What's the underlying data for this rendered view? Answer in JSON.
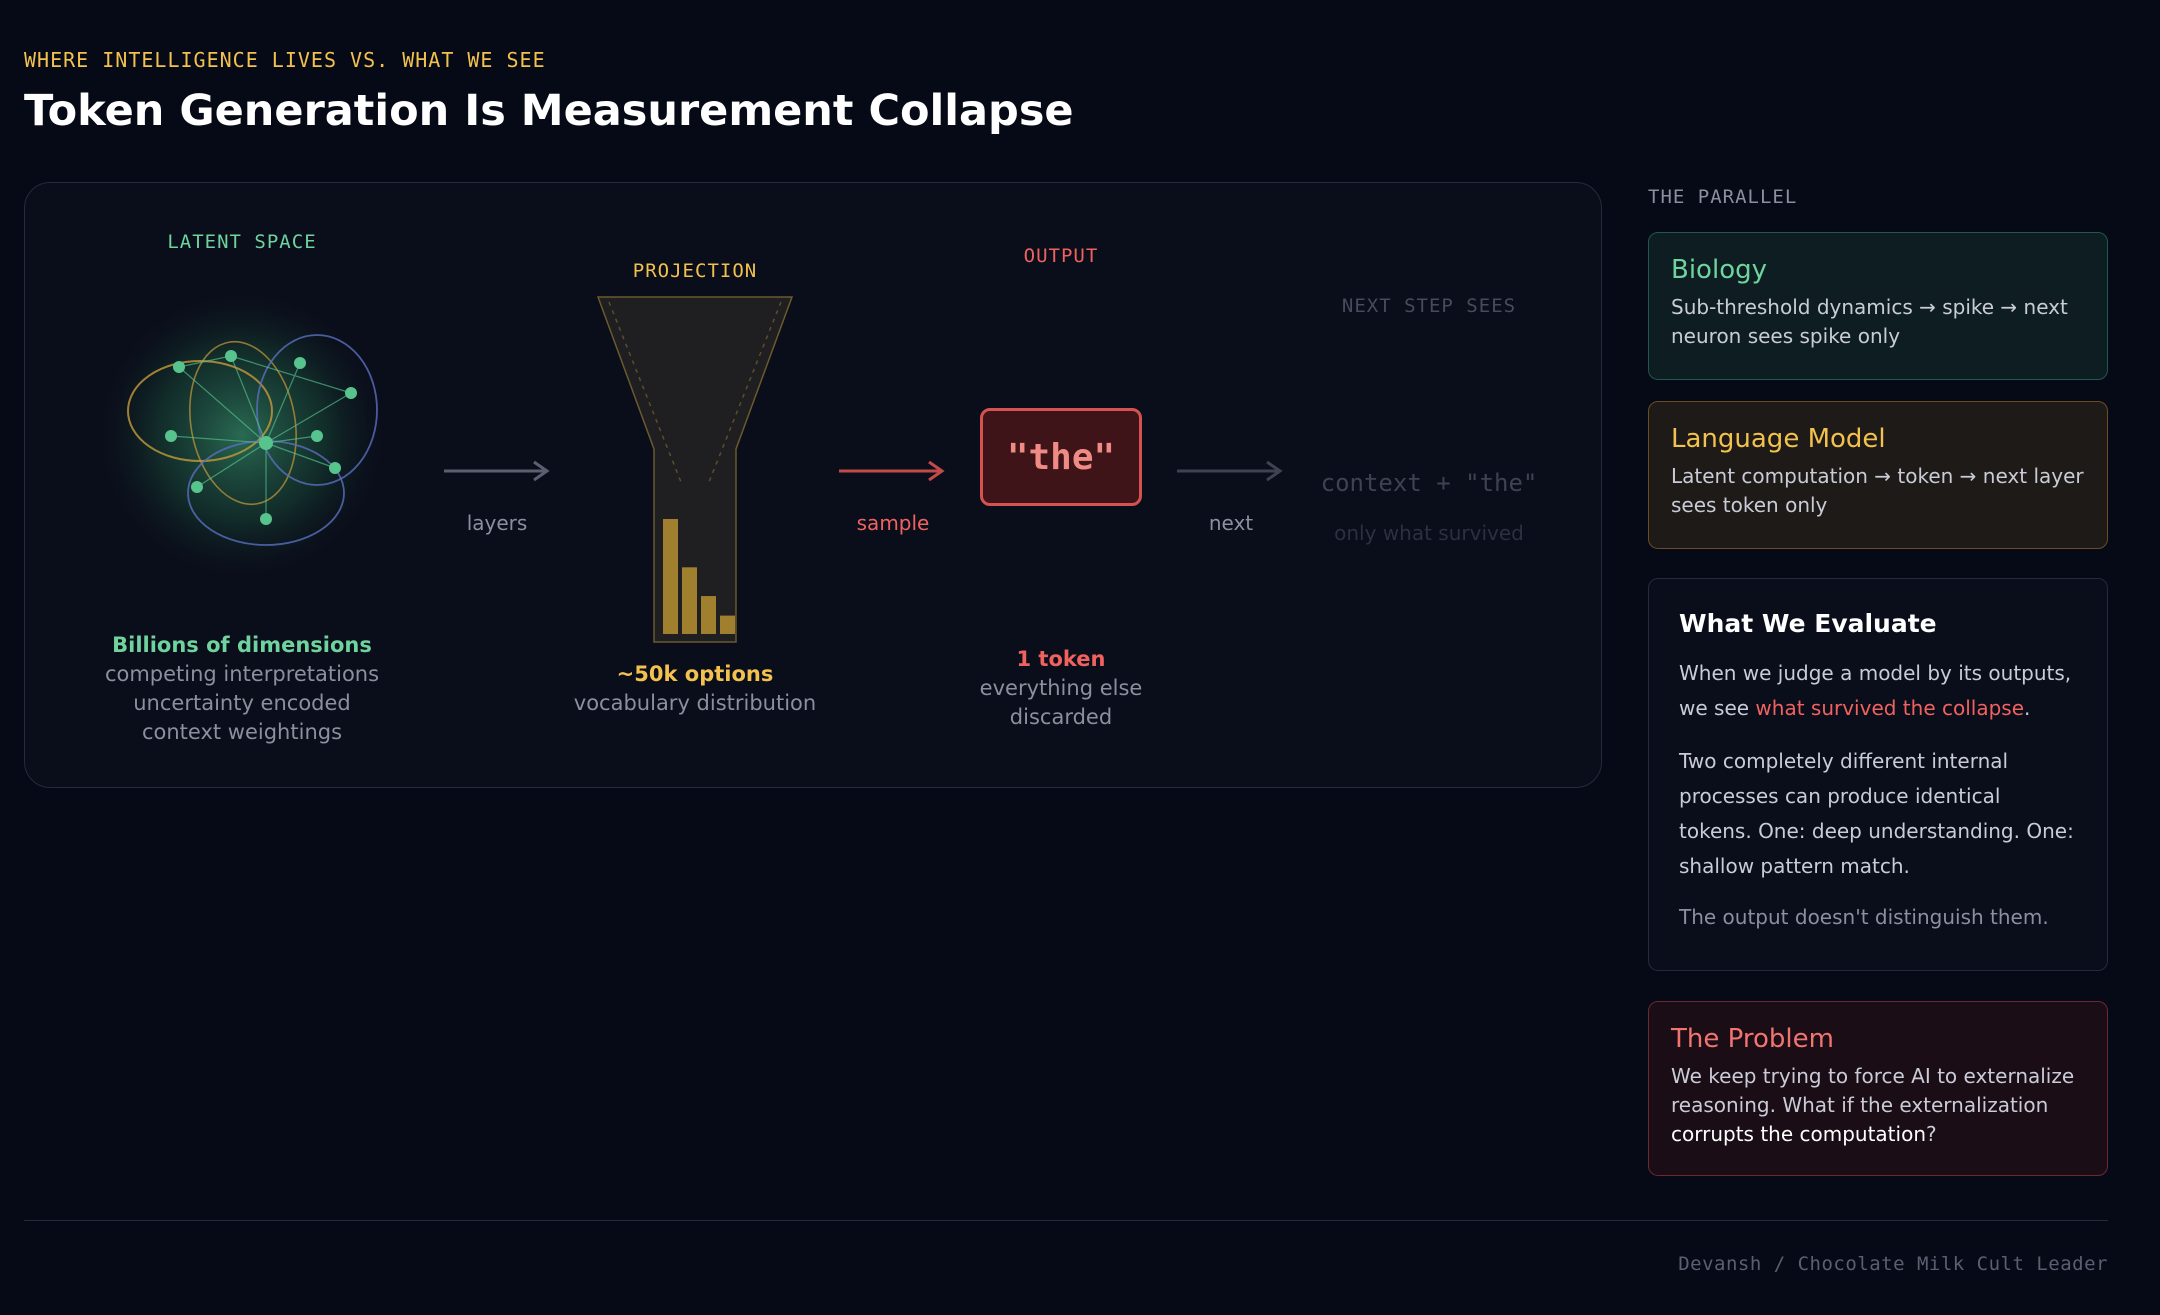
{
  "header": {
    "eyebrow": "WHERE INTELLIGENCE LIVES VS. WHAT WE SEE",
    "title": "Token Generation Is Measurement Collapse"
  },
  "diagram": {
    "latent": {
      "label": "LATENT SPACE",
      "caption_title": "Billions of dimensions",
      "caption_lines": [
        "competing interpretations",
        "uncertainty encoded",
        "context weightings"
      ]
    },
    "arrow_layers": "layers",
    "projection": {
      "label": "PROJECTION",
      "caption_title": "~50k options",
      "caption_line": "vocabulary distribution",
      "bar_values": [
        1.0,
        0.58,
        0.33,
        0.16
      ]
    },
    "arrow_sample": "sample",
    "output": {
      "label": "OUTPUT",
      "token": "\"the\"",
      "caption_title": "1 token",
      "caption_lines": [
        "everything else",
        "discarded"
      ]
    },
    "arrow_next": "next",
    "next_step": {
      "label": "NEXT STEP SEES",
      "context": "context + \"the\"",
      "sub": "only what survived"
    }
  },
  "sidebar": {
    "heading": "THE PARALLEL",
    "biology": {
      "title": "Biology",
      "text": "Sub-threshold dynamics → spike → next neuron sees spike only"
    },
    "language_model": {
      "title": "Language Model",
      "text": "Latent computation → token → next layer sees token only"
    },
    "evaluate": {
      "title": "What We Evaluate",
      "p1_prefix": "When we judge a model by its outputs, we see ",
      "p1_highlight": "what survived the collapse",
      "p1_suffix": ".",
      "p2": "Two completely different internal processes can produce identical tokens. One: deep understanding. One: shallow pattern match.",
      "p3": "The output doesn't distinguish them."
    },
    "problem": {
      "title": "The Problem",
      "text_prefix": "We keep trying to force AI to externalize reasoning. What if the externalization ",
      "text_highlight": "corrupts the computation",
      "text_suffix": "?"
    }
  },
  "footer": {
    "credit": "Devansh / Chocolate Milk Cult Leader"
  },
  "colors": {
    "green": "#6fd39e",
    "gold": "#f2c14e",
    "red": "#f0625f",
    "background": "#060916"
  }
}
